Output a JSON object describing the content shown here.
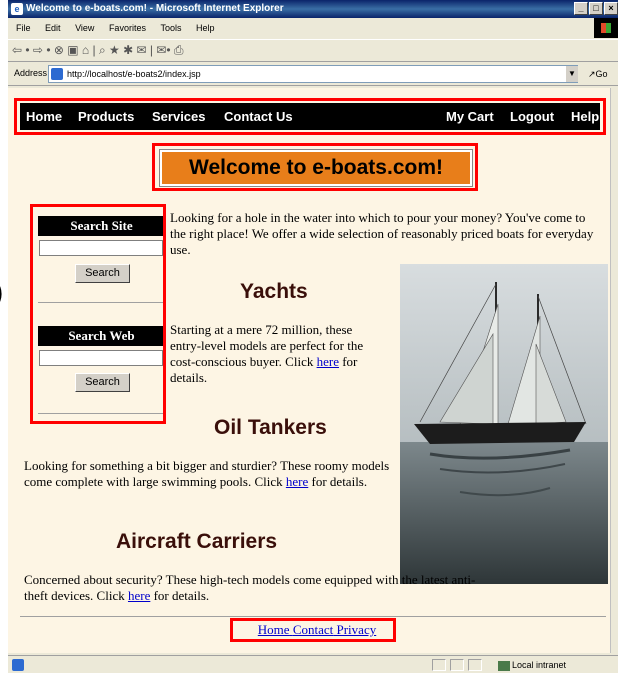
{
  "window": {
    "title": "Welcome to e-boats.com! - Microsoft Internet Explorer",
    "menu": [
      "File",
      "Edit",
      "View",
      "Favorites",
      "Tools",
      "Help"
    ],
    "toolbar_glyphs": "⇦ • ⇨ • ⊗ ▣ ⌂ | ⌕ ★ ✱ ✉ | ✉• ⎙",
    "address_label": "Address",
    "address_url": "http://localhost/e-boats2/index.jsp",
    "go_label": "Go",
    "status_zone": "Local intranet"
  },
  "nav": {
    "left": [
      "Home",
      "Products",
      "Services",
      "Contact Us"
    ],
    "right": [
      "My Cart",
      "Logout",
      "Help"
    ]
  },
  "welcome": "Welcome to e-boats.com!",
  "sidebar": {
    "search_site_title": "Search Site",
    "search_site_value": "",
    "search_site_button": "Search",
    "search_web_title": "Search Web",
    "search_web_value": "",
    "search_web_button": "Search"
  },
  "intro": "Looking for a hole in the water into which to pour your money? You've come to the right place! We offer a wide selection of reasonably priced boats for everyday use.",
  "sections": {
    "yachts": {
      "title": "Yachts",
      "text": "Starting at a mere 72 million, these entry-level models are perfect for the cost-conscious buyer. Click",
      "link": "here",
      "tail": "for details."
    },
    "tankers": {
      "title": "Oil Tankers",
      "text": "Looking for something a bit bigger and sturdier? These roomy models come complete with large swimming pools. Click",
      "link": "here",
      "tail": "for details."
    },
    "carriers": {
      "title": "Aircraft Carriers",
      "text": "Concerned about security? These high-tech models come equipped with the latest anti-theft devices. Click",
      "link": "here",
      "tail": "for details."
    }
  },
  "footer": [
    "Home",
    "Contact",
    "Privacy"
  ],
  "left_fragment": ")"
}
